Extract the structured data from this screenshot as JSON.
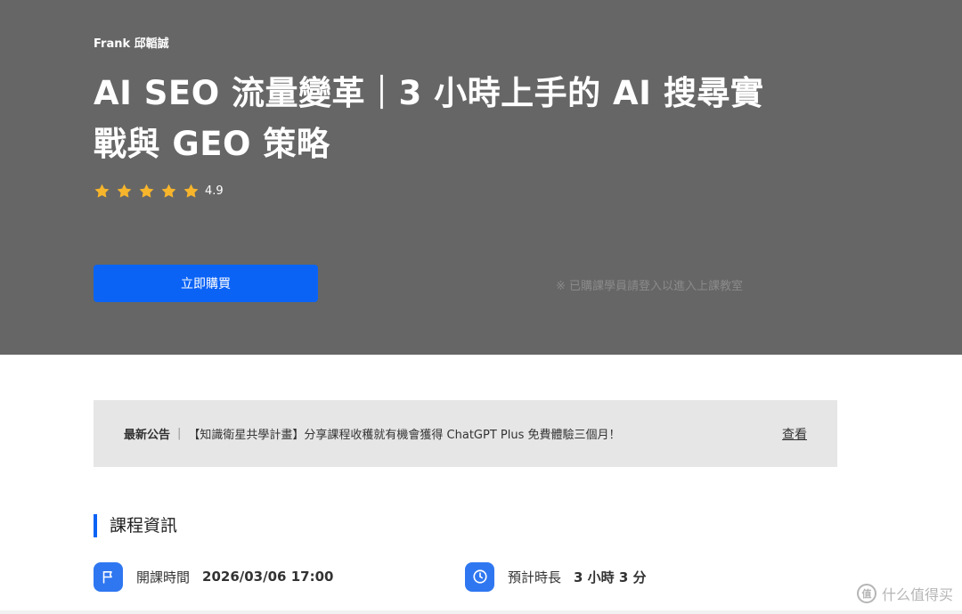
{
  "hero": {
    "author": "Frank 邱韜誠",
    "title": "AI SEO 流量變革｜3 小時上手的 AI 搜尋實戰與 GEO 策略",
    "rating": {
      "value": "4.9",
      "stars": 5
    },
    "buy_button": "立即購買",
    "enrolled_note": "※ 已購課學員請登入以進入上課教室"
  },
  "notice": {
    "label": "最新公告",
    "separator": "|",
    "text": "【知識衛星共學計畫】分享課程收穫就有機會獲得 ChatGPT Plus 免費體驗三個月！",
    "link": "查看"
  },
  "course_info": {
    "section_title": "課程資訊",
    "start_time_label": "開課時間",
    "start_time_value": "2026/03/06 17:00",
    "duration_label": "預計時長",
    "duration_value": "3 小時 3 分"
  },
  "watermark": {
    "logo_text": "值",
    "text": "什么值得买"
  },
  "colors": {
    "accent": "#0b63f6",
    "hero_bg": "#666666",
    "star": "#f7b52c"
  }
}
